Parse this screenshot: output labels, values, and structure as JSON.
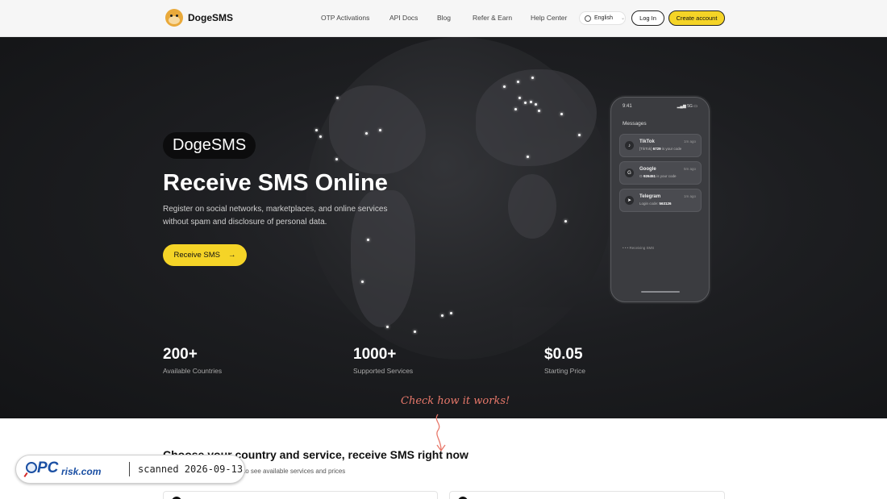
{
  "header": {
    "brand": "DogeSMS",
    "nav": [
      "OTP Activations",
      "API Docs",
      "Blog",
      "Refer & Earn",
      "Help Center"
    ],
    "language": "English",
    "login_label": "Log In",
    "create_label": "Create account"
  },
  "hero": {
    "brand_pill": "DogeSMS",
    "title": "Receive SMS Online",
    "description": "Register on social networks, marketplaces, and online services without spam and disclosure of personal data.",
    "cta_label": "Receive SMS",
    "cta_icon": "arrow-right-icon"
  },
  "stats": [
    {
      "value": "200+",
      "label": "Available Countries"
    },
    {
      "value": "1000+",
      "label": "Supported Services"
    },
    {
      "value": "$0.05",
      "label": "Starting Price"
    }
  ],
  "check_text": "Check how it works!",
  "phone": {
    "time": "9:41",
    "signal": "5G",
    "heading": "Messages",
    "messages": [
      {
        "app": "TikTok",
        "icon": "tiktok-icon",
        "prefix": "[TikTok] ",
        "code": "6729",
        "suffix": " is your code",
        "time": "1m ago"
      },
      {
        "app": "Google",
        "icon": "google-icon",
        "prefix": "G-",
        "code": "926451",
        "suffix": " is your code",
        "time": "5m ago"
      },
      {
        "app": "Telegram",
        "icon": "telegram-icon",
        "prefix": "Login code: ",
        "code": "563126",
        "suffix": "",
        "time": "1m ago"
      }
    ],
    "typing": "Receiving SMS"
  },
  "section": {
    "title": "Choose your country and service, receive SMS right now",
    "subtitle": "to see available services and prices"
  },
  "watermark": {
    "logo_pc": "PC",
    "logo_risk": "risk.com",
    "text": "scanned 2026-09-13"
  },
  "colors": {
    "accent": "#f5d427",
    "hero_bg": "#1d1e21",
    "check_color": "#e8786a",
    "watermark_blue": "#1a4fa3"
  }
}
